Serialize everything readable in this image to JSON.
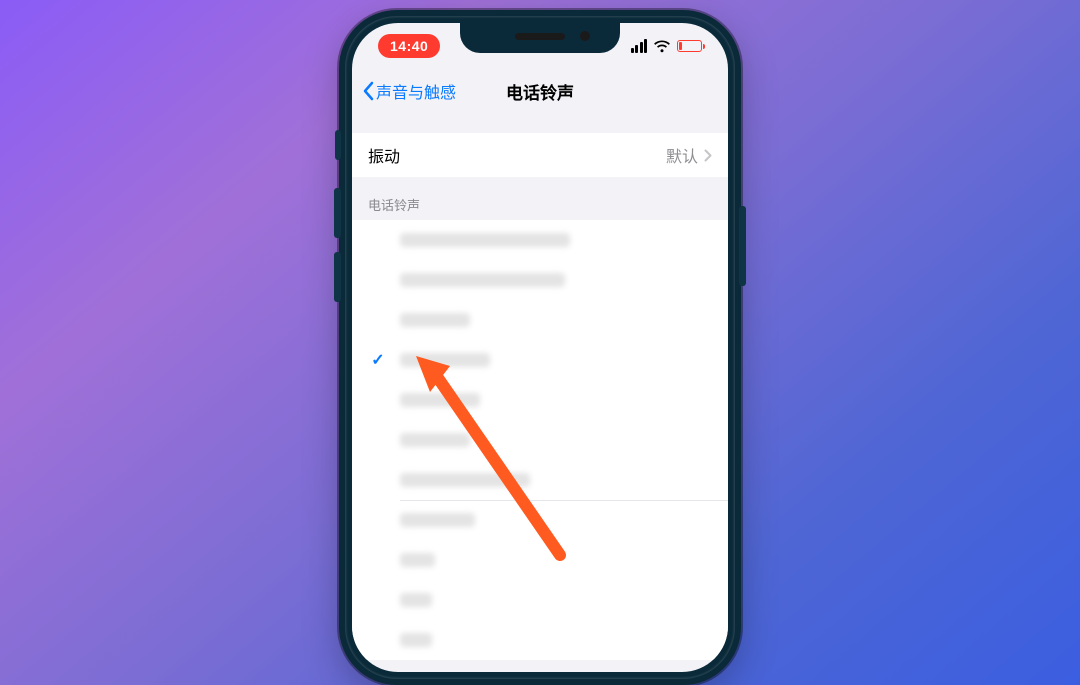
{
  "status": {
    "time": "14:40"
  },
  "nav": {
    "back_label": "声音与触感",
    "title": "电话铃声"
  },
  "vibration": {
    "label": "振动",
    "value": "默认"
  },
  "section_header": "电话铃声"
}
